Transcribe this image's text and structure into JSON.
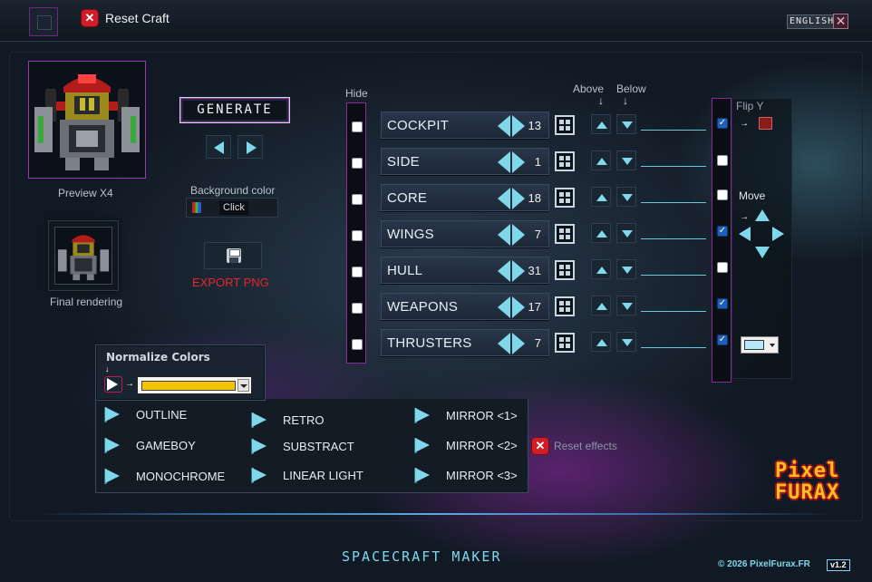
{
  "header": {
    "reset_craft_label": "Reset Craft",
    "reset_icon": "close-x-red-icon",
    "language_label": "ENGLISH",
    "close_icon": "close-icon"
  },
  "preview": {
    "preview_label": "Preview X4",
    "final_label": "Final rendering"
  },
  "controls": {
    "generate_label": "GENERATE",
    "background_color_label": "Background color",
    "background_click_label": "Click",
    "export_label": "EXPORT PNG"
  },
  "parts_header": {
    "hide_label": "Hide",
    "above_label": "Above",
    "below_label": "Below",
    "arrow_down_glyph": "↓"
  },
  "parts": [
    {
      "name": "COCKPIT",
      "value": "13",
      "hidden": false,
      "flipped": true
    },
    {
      "name": "SIDE",
      "value": "1",
      "hidden": false,
      "flipped": false
    },
    {
      "name": "CORE",
      "value": "18",
      "hidden": false,
      "flipped": false
    },
    {
      "name": "WINGS",
      "value": "7",
      "hidden": false,
      "flipped": true
    },
    {
      "name": "HULL",
      "value": "31",
      "hidden": false,
      "flipped": false
    },
    {
      "name": "WEAPONS",
      "value": "17",
      "hidden": false,
      "flipped": true
    },
    {
      "name": "THRUSTERS",
      "value": "7",
      "hidden": false,
      "flipped": true
    }
  ],
  "right_panel": {
    "flip_y_label": "Flip Y",
    "move_label": "Move",
    "arrow_glyph": "→",
    "flip_color": "#8a1b1b",
    "pick_color": "#b8e8f8"
  },
  "normalize": {
    "label": "Normalize Colors",
    "arrow_down_glyph": "↓",
    "arrow_glyph": "→",
    "selected_color": "#f5c400"
  },
  "effects": {
    "col1": [
      "OUTLINE",
      "GAMEBOY",
      "MONOCHROME"
    ],
    "col2": [
      "RETRO",
      "SUBSTRACT",
      "LINEAR LIGHT"
    ],
    "col3": [
      "MIRROR <1>",
      "MIRROR <2>",
      "MIRROR <3>"
    ],
    "reset_label": "Reset effects"
  },
  "footer": {
    "title": "SPACECRAFT MAKER",
    "copyright": "© 2026 PixelFurax.FR",
    "version": "v1.2",
    "logo_line1": "Pixel",
    "logo_line2": "FURAX"
  }
}
